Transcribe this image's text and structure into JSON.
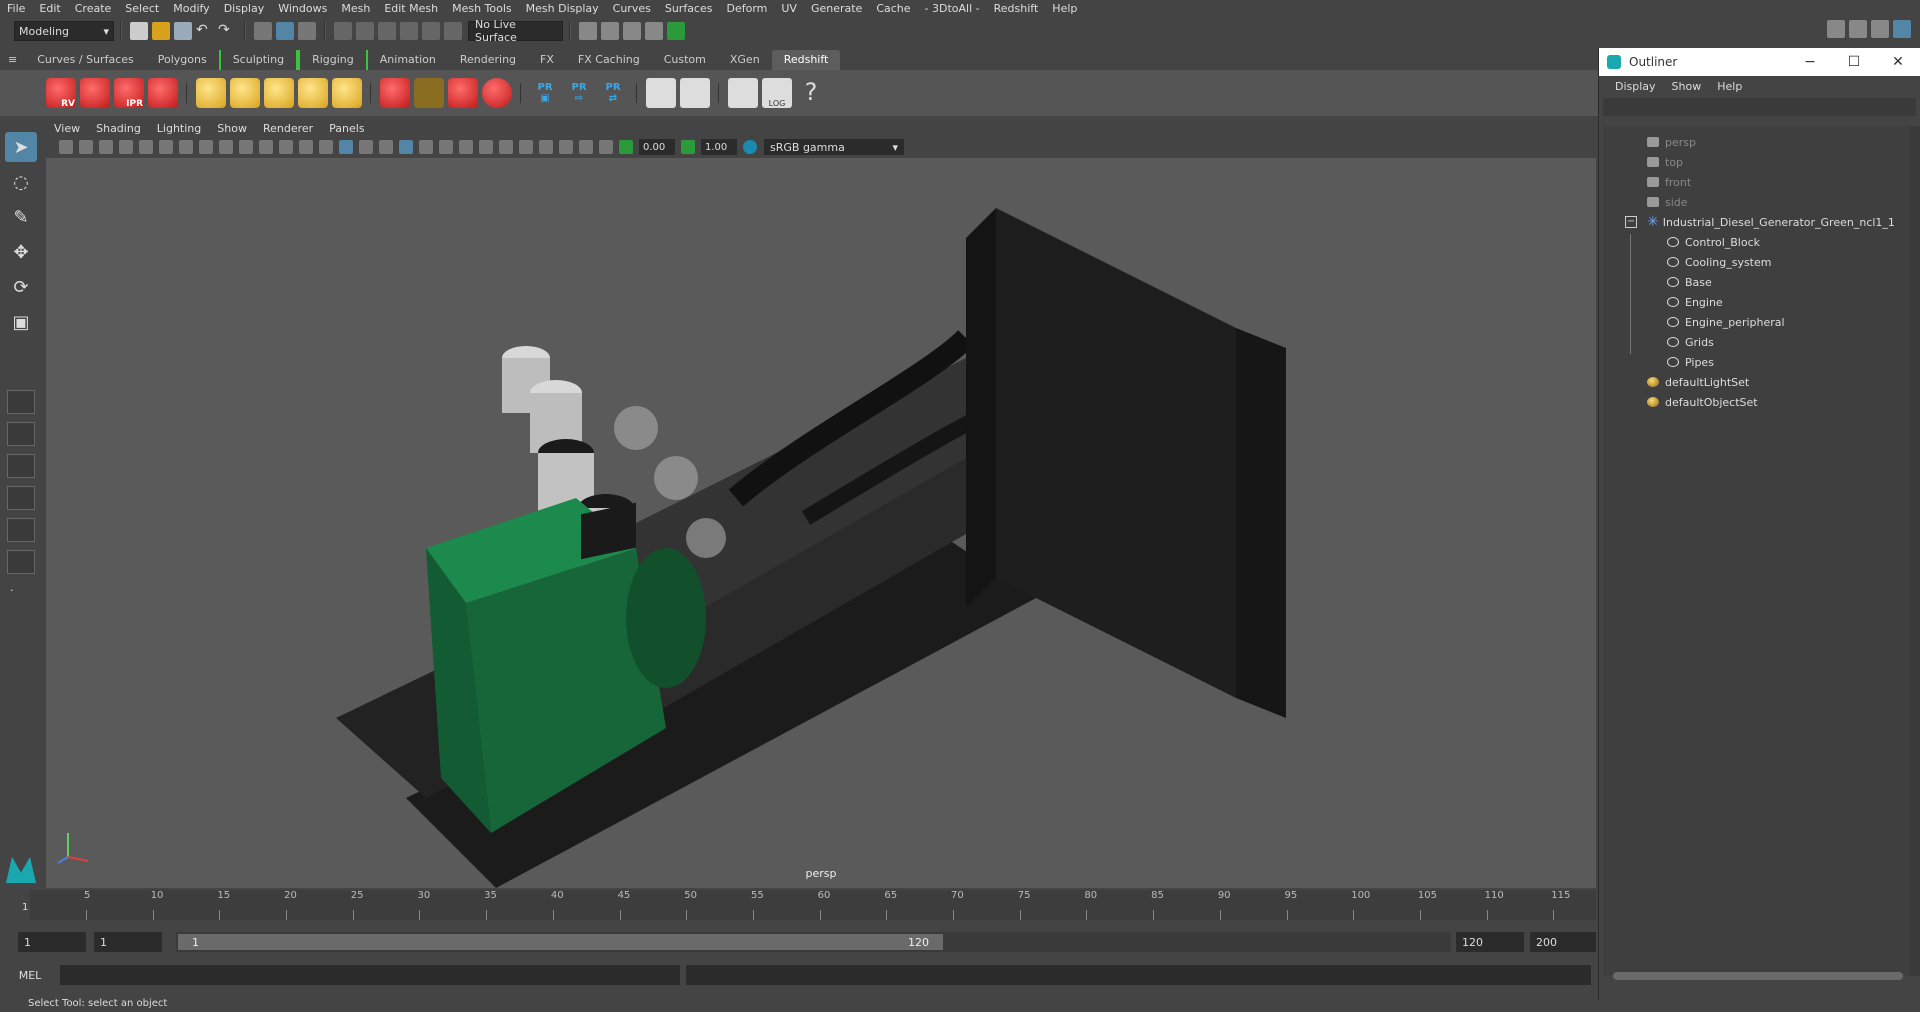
{
  "menubar": {
    "items": [
      "File",
      "Edit",
      "Create",
      "Select",
      "Modify",
      "Display",
      "Windows",
      "Mesh",
      "Edit Mesh",
      "Mesh Tools",
      "Mesh Display",
      "Curves",
      "Surfaces",
      "Deform",
      "UV",
      "Generate",
      "Cache",
      "- 3DtoAll -",
      "Redshift",
      "Help"
    ]
  },
  "statusline": {
    "mode": "Modeling",
    "live_surface": "No Live Surface"
  },
  "shelf": {
    "tabs": [
      "Curves / Surfaces",
      "Polygons",
      "Sculpting",
      "Rigging",
      "Animation",
      "Rendering",
      "FX",
      "FX Caching",
      "Custom",
      "XGen",
      "Redshift"
    ],
    "active_tab": "Redshift",
    "icon_labels": {
      "rv": "RV",
      "ipr": "IPR",
      "pr": "PR",
      "log": "LOG",
      "help": "?"
    }
  },
  "viewport": {
    "menu": [
      "View",
      "Shading",
      "Lighting",
      "Show",
      "Renderer",
      "Panels"
    ],
    "exposure": "0.00",
    "gamma": "1.00",
    "color_space": "sRGB gamma",
    "camera_label": "persp"
  },
  "timeline": {
    "ticks": [
      "5",
      "10",
      "15",
      "20",
      "25",
      "30",
      "35",
      "40",
      "45",
      "50",
      "55",
      "60",
      "65",
      "70",
      "75",
      "80",
      "85",
      "90",
      "95",
      "100",
      "105",
      "110",
      "115"
    ],
    "current_frame": "1"
  },
  "range": {
    "start": "1",
    "playback_start": "1",
    "slider_start": "1",
    "slider_end": "120",
    "playback_end": "120",
    "end": "200"
  },
  "cmdline": {
    "label": "MEL"
  },
  "helpline": {
    "text": "Select Tool: select an object"
  },
  "outliner": {
    "title": "Outliner",
    "menu": [
      "Display",
      "Show",
      "Help"
    ],
    "cameras": [
      "persp",
      "top",
      "front",
      "side"
    ],
    "group": "Industrial_Diesel_Generator_Green_ncl1_1",
    "children": [
      "Control_Block",
      "Cooling_system",
      "Base",
      "Engine",
      "Engine_peripheral",
      "Grids",
      "Pipes"
    ],
    "sets": [
      "defaultLightSet",
      "defaultObjectSet"
    ]
  },
  "colors": {
    "accent": "#5285a6",
    "generator_green": "#17663a",
    "redshift_red": "#d02424",
    "viewport_bg": "#5a5a5a"
  }
}
